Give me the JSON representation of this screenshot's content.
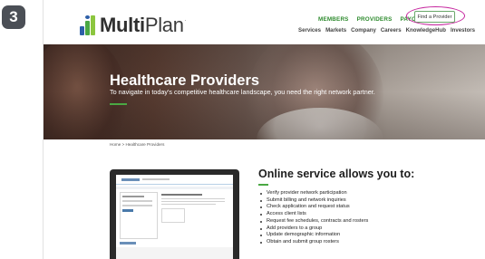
{
  "step_number": "3",
  "logo": {
    "text_prefix": "Multi",
    "text_suffix": "Plan",
    "tm": "."
  },
  "top_nav": [
    "MEMBERS",
    "PROVIDERS",
    "PAYORS"
  ],
  "find_provider_label": "Find a Provider",
  "sub_nav": [
    "Services",
    "Markets",
    "Company",
    "Careers",
    "KnowledgeHub",
    "Investors"
  ],
  "hero": {
    "title": "Healthcare Providers",
    "subtitle": "To navigate in today’s competitive healthcare landscape, you need the right network partner."
  },
  "breadcrumb": "Home > Healthcare Providers",
  "services": {
    "title": "Online service allows you to:",
    "items": [
      "Verify provider network participation",
      "Submit billing and network inquiries",
      "Check application and request status",
      "Access client lists",
      "Request fee schedules, contracts and rosters",
      "Add providers to a group",
      "Update demographic information",
      "Obtain and submit group rosters"
    ]
  },
  "colors": {
    "accent_green": "#4aa843",
    "nav_green": "#2e8b2e",
    "highlight_magenta": "#c4219c",
    "badge_gray": "#4b4f56"
  }
}
